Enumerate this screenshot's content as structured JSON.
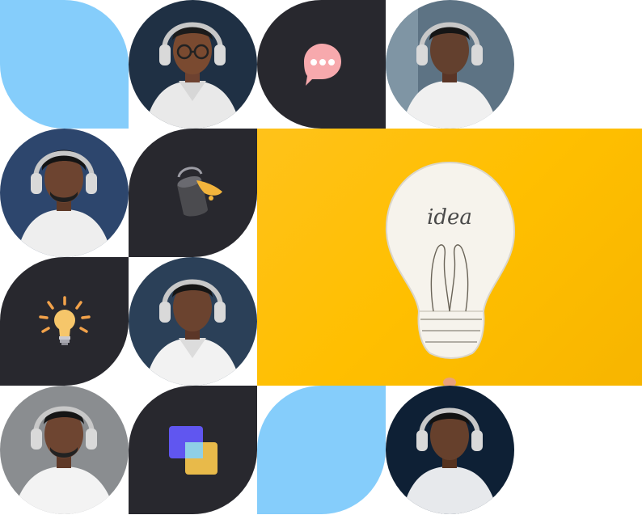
{
  "palette": {
    "blue": "#85cdfb",
    "dark": "#28282e",
    "yellow": "#ffbf00",
    "hoodie": "#eeeeee",
    "skin": "#7a4a30"
  },
  "tiles": [
    {
      "kind": "shape",
      "shape": "leaf-blue"
    },
    {
      "kind": "avatar",
      "background": "#1f3044",
      "glasses": true
    },
    {
      "kind": "icon",
      "icon": "chat-bubble-icon"
    },
    {
      "kind": "avatar",
      "background": "#5d7384",
      "glasses": false
    },
    {
      "kind": "avatar",
      "background": "#2d466d",
      "glasses": false
    },
    {
      "kind": "icon",
      "icon": "paint-bucket-icon"
    },
    {
      "kind": "icon",
      "icon": "light-bulb-icon"
    },
    {
      "kind": "avatar",
      "background": "#2b4058",
      "glasses": false
    },
    {
      "kind": "avatar",
      "background": "#8a8d90",
      "glasses": false
    },
    {
      "kind": "icon",
      "icon": "layers-icon"
    },
    {
      "kind": "shape",
      "shape": "leaf-blue"
    },
    {
      "kind": "avatar",
      "background": "#0e2035",
      "glasses": false
    }
  ],
  "hero": {
    "image": "idea-light-bulb-icon",
    "handwriting": "idea"
  }
}
